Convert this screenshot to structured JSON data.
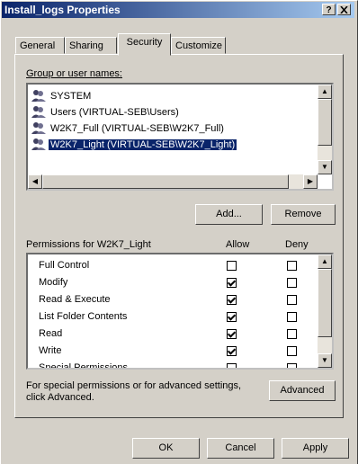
{
  "window": {
    "title": "Install_logs Properties",
    "help_button": "?",
    "close_button": "x"
  },
  "tabs": [
    {
      "label": "General",
      "active": false
    },
    {
      "label": "Sharing",
      "active": false
    },
    {
      "label": "Security",
      "active": true
    },
    {
      "label": "Customize",
      "active": false
    }
  ],
  "users": {
    "label": "Group or user names:",
    "items": [
      {
        "name": "SYSTEM",
        "selected": false
      },
      {
        "name": "Users (VIRTUAL-SEB\\Users)",
        "selected": false
      },
      {
        "name": "W2K7_Full (VIRTUAL-SEB\\W2K7_Full)",
        "selected": false
      },
      {
        "name": "W2K7_Light (VIRTUAL-SEB\\W2K7_Light)",
        "selected": true
      }
    ],
    "add_button": "Add...",
    "remove_button": "Remove"
  },
  "permissions": {
    "label": "Permissions for W2K7_Light",
    "allow_header": "Allow",
    "deny_header": "Deny",
    "rows": [
      {
        "name": "Full Control",
        "allow": false,
        "deny": false
      },
      {
        "name": "Modify",
        "allow": true,
        "deny": false
      },
      {
        "name": "Read & Execute",
        "allow": true,
        "deny": false
      },
      {
        "name": "List Folder Contents",
        "allow": true,
        "deny": false
      },
      {
        "name": "Read",
        "allow": true,
        "deny": false
      },
      {
        "name": "Write",
        "allow": true,
        "deny": false
      },
      {
        "name": "Special Permissions",
        "allow": false,
        "deny": false
      }
    ]
  },
  "advanced": {
    "text_line1": "For special permissions or for advanced settings,",
    "text_line2": "click Advanced.",
    "button": "Advanced"
  },
  "footer": {
    "ok": "OK",
    "cancel": "Cancel",
    "apply": "Apply"
  }
}
